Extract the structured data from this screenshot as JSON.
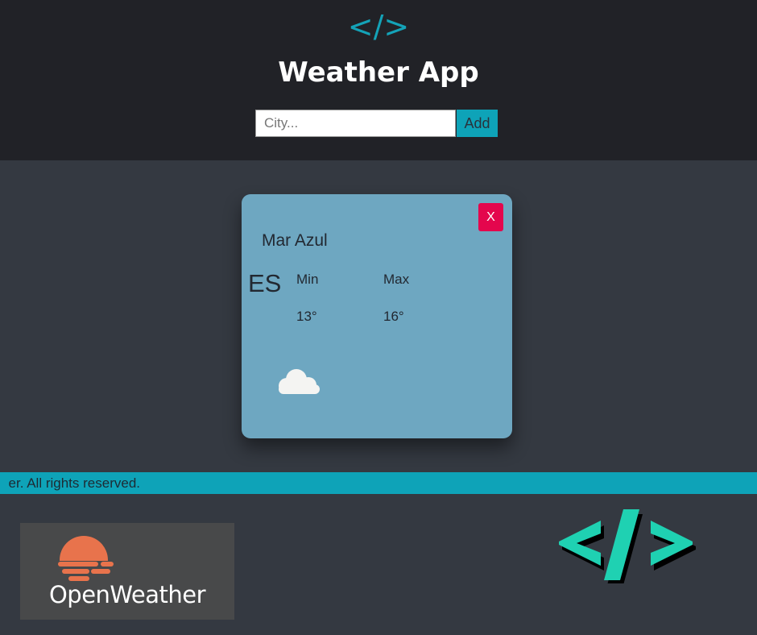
{
  "header": {
    "logo_text": "</>",
    "title": "Weather App"
  },
  "search": {
    "placeholder": "City...",
    "value": "",
    "add_label": "Add"
  },
  "card": {
    "close_label": "X",
    "city": "Mar Azul",
    "country": "ES",
    "min_label": "Min",
    "max_label": "Max",
    "min_value": "13°",
    "max_value": "16°",
    "icon": "cloud-icon"
  },
  "footer": {
    "text": "er. All rights reserved."
  },
  "branding": {
    "openweather_text": "OpenWeather",
    "code_logo_icon": "code-brackets-icon"
  },
  "colors": {
    "header_bg": "#212227",
    "page_bg": "#343941",
    "accent": "#0ea3b8",
    "card_bg": "#6ea7c1",
    "close_red": "#e4064d",
    "openweather_orange": "#e8734c",
    "code_logo_teal": "#1fd1b2"
  }
}
